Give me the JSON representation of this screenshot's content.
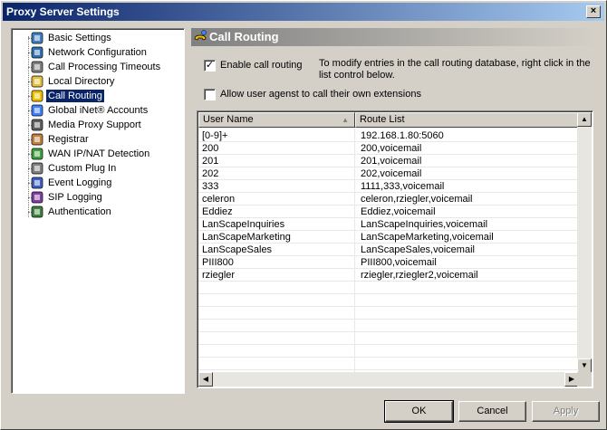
{
  "window": {
    "title": "Proxy Server Settings",
    "close_glyph": "×"
  },
  "tree": {
    "items": [
      {
        "label": "Basic Settings",
        "icon": "gear-icon"
      },
      {
        "label": "Network Configuration",
        "icon": "network-icon"
      },
      {
        "label": "Call Processing Timeouts",
        "icon": "clock-icon"
      },
      {
        "label": "Local Directory",
        "icon": "folder-icon"
      },
      {
        "label": "Call Routing",
        "icon": "phone-icon",
        "selected": true
      },
      {
        "label": "Global iNet® Accounts",
        "icon": "key-icon"
      },
      {
        "label": "Media Proxy Support",
        "icon": "speaker-icon"
      },
      {
        "label": "Registrar",
        "icon": "registrar-icon"
      },
      {
        "label": "WAN IP/NAT Detection",
        "icon": "wan-icon"
      },
      {
        "label": "Custom Plug In",
        "icon": "plugin-icon"
      },
      {
        "label": "Event Logging",
        "icon": "event-icon"
      },
      {
        "label": "SIP Logging",
        "icon": "book-icon"
      },
      {
        "label": "Authentication",
        "icon": "auth-icon"
      }
    ]
  },
  "section": {
    "title": "Call Routing",
    "icon": "phone-icon"
  },
  "options": {
    "enable_routing_label": "Enable call routing",
    "enable_routing_checked": "✓",
    "help_text": "To modify entries in the call routing database, right click in the list control below.",
    "allow_own_label": "Allow user agenst to call their own extensions",
    "allow_own_checked": ""
  },
  "table": {
    "columns": [
      "User Name",
      "Route List"
    ],
    "sort_glyph": "▲",
    "rows": [
      [
        "[0-9]+",
        "192.168.1.80:5060"
      ],
      [
        "200",
        "200,voicemail"
      ],
      [
        "201",
        "201,voicemail"
      ],
      [
        "202",
        "202,voicemail"
      ],
      [
        "333",
        "1111,333,voicemail"
      ],
      [
        "celeron",
        "celeron,rziegler,voicemail"
      ],
      [
        "Eddiez",
        "Eddiez,voicemail"
      ],
      [
        "LanScapeInquiries",
        "LanScapeInquiries,voicemail"
      ],
      [
        "LanScapeMarketing",
        "LanScapeMarketing,voicemail"
      ],
      [
        "LanScapeSales",
        "LanScapeSales,voicemail"
      ],
      [
        "PIII800",
        "PIII800,voicemail"
      ],
      [
        "rziegler",
        "rziegler,rziegler2,voicemail"
      ]
    ]
  },
  "buttons": {
    "ok": "OK",
    "cancel": "Cancel",
    "apply": "Apply"
  }
}
